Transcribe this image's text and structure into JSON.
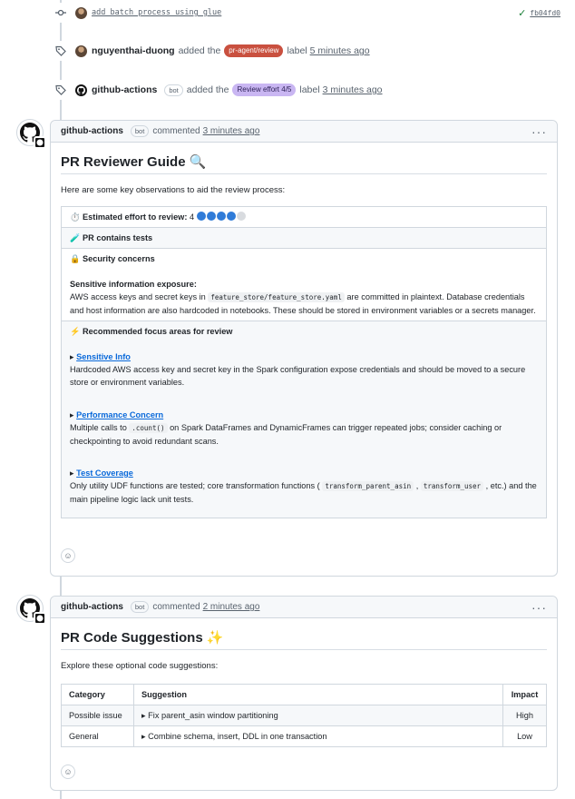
{
  "commit": {
    "message": "add batch process using glue",
    "sha": "fb04fd0",
    "status_icon": "check-icon"
  },
  "events": [
    {
      "author": "nguyenthai-duong",
      "action": "added the",
      "label": "pr-agent/review",
      "label_bg": "#c9503f",
      "label_fg": "#ffffff",
      "suffix": "label",
      "time": "5 minutes ago"
    },
    {
      "author": "github-actions",
      "bot_tag": "bot",
      "action": "added the",
      "label": "Review effort 4/5",
      "label_bg": "#c9b6f2",
      "label_fg": "#2b1f55",
      "suffix": "label",
      "time": "3 minutes ago"
    }
  ],
  "reviewer_comment": {
    "author": "github-actions",
    "bot_tag": "bot",
    "action": "commented",
    "time": "3 minutes ago",
    "menu": "···",
    "title": "PR Reviewer Guide 🔍",
    "intro": "Here are some key observations to aid the review process:",
    "effort": {
      "icon": "⏱️",
      "label": "Estimated effort to review:",
      "value": "4",
      "filled": 4,
      "total": 5
    },
    "tests": {
      "icon": "🧪",
      "label": "PR contains tests"
    },
    "security": {
      "icon": "🔒",
      "label": "Security concerns",
      "subtitle": "Sensitive information exposure:",
      "text_before": "AWS access keys and secret keys in",
      "code": "feature_store/feature_store.yaml",
      "text_after": "are committed in plaintext. Database credentials and host information are also hardcoded in notebooks. These should be stored in environment variables or a secrets manager."
    },
    "focus": {
      "icon": "⚡",
      "label": "Recommended focus areas for review",
      "items": [
        {
          "title": "Sensitive Info",
          "text": "Hardcoded AWS access key and secret key in the Spark configuration expose credentials and should be moved to a secure store or environment variables."
        },
        {
          "title": "Performance Concern",
          "text_before": "Multiple calls to",
          "code": ".count()",
          "text_after": "on Spark DataFrames and DynamicFrames can trigger repeated jobs; consider caching or checkpointing to avoid redundant scans."
        },
        {
          "title": "Test Coverage",
          "text_before": "Only utility UDF functions are tested; core transformation functions (",
          "code1": "transform_parent_asin",
          "sep": ",",
          "code2": "transform_user",
          "text_after": ", etc.) and the main pipeline logic lack unit tests."
        }
      ]
    }
  },
  "suggestions_comment": {
    "author": "github-actions",
    "bot_tag": "bot",
    "action": "commented",
    "time": "2 minutes ago",
    "menu": "···",
    "title": "PR Code Suggestions ✨",
    "intro": "Explore these optional code suggestions:",
    "headers": {
      "category": "Category",
      "suggestion": "Suggestion",
      "impact": "Impact"
    },
    "rows": [
      {
        "category": "Possible issue",
        "suggestion": "Fix parent_asin window partitioning",
        "impact": "High"
      },
      {
        "category": "General",
        "suggestion": "Combine schema, insert, DDL in one transaction",
        "impact": "Low"
      }
    ]
  },
  "reaction_icon": "smiley-icon"
}
